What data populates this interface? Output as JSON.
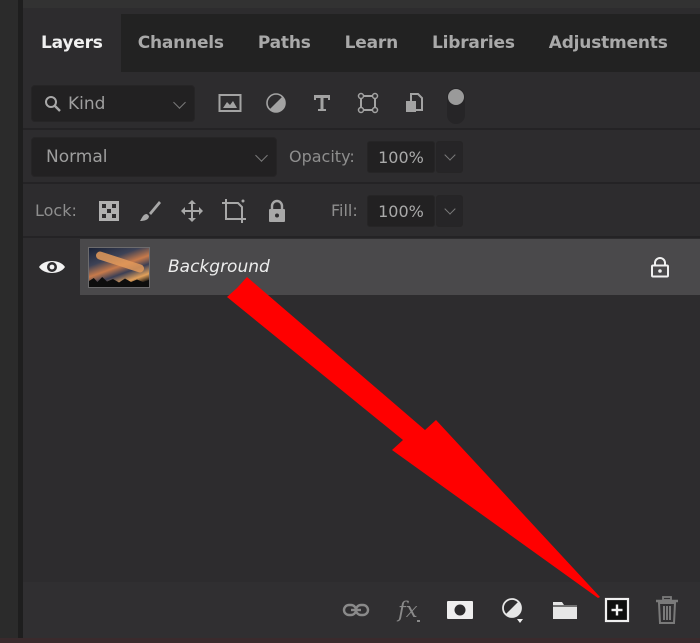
{
  "panel": {
    "tabs": [
      {
        "label": "Layers",
        "active": true
      },
      {
        "label": "Channels",
        "active": false
      },
      {
        "label": "Paths",
        "active": false
      },
      {
        "label": "Learn",
        "active": false
      },
      {
        "label": "Libraries",
        "active": false
      },
      {
        "label": "Adjustments",
        "active": false
      }
    ]
  },
  "filter": {
    "kind_label": "Kind",
    "icons": [
      "pixel-layer-filter-icon",
      "adjustment-layer-filter-icon",
      "type-layer-filter-icon",
      "shape-layer-filter-icon",
      "smart-object-filter-icon"
    ],
    "toggle_on": false
  },
  "blend": {
    "mode": "Normal",
    "opacity_label": "Opacity:",
    "opacity_value": "100%"
  },
  "lock": {
    "label": "Lock:",
    "icons": [
      "lock-transparent-pixels-icon",
      "lock-image-pixels-icon",
      "lock-position-icon",
      "lock-artboard-icon",
      "lock-all-icon"
    ],
    "fill_label": "Fill:",
    "fill_value": "100%"
  },
  "layers": [
    {
      "name": "Background",
      "visible": true,
      "locked": true,
      "selected": true
    }
  ],
  "bottom_bar": {
    "icons": [
      "link-layers-icon",
      "layer-style-fx-icon",
      "add-mask-icon",
      "adjustment-layer-icon",
      "new-group-icon",
      "new-layer-icon",
      "delete-layer-icon"
    ]
  },
  "annotation": {
    "arrow_color": "#ff0000",
    "points_to": "new-layer-button"
  }
}
